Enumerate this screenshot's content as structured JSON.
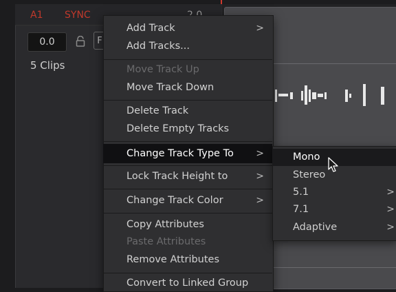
{
  "track_header": {
    "track_id": "A1",
    "sync_label": "SYNC",
    "track_number": "2.0",
    "volume": "0.0",
    "button_label": "F",
    "clips_count": "5 Clips"
  },
  "context_menu": {
    "items": [
      {
        "label": "Add Track"
      },
      {
        "label": "Add Tracks..."
      },
      {
        "label": "Move Track Up"
      },
      {
        "label": "Move Track Down"
      },
      {
        "label": "Delete Track"
      },
      {
        "label": "Delete Empty Tracks"
      },
      {
        "label": "Change Track Type To"
      },
      {
        "label": "Lock Track Height to"
      },
      {
        "label": "Change Track Color"
      },
      {
        "label": "Copy Attributes"
      },
      {
        "label": "Paste Attributes"
      },
      {
        "label": "Remove Attributes"
      },
      {
        "label": "Convert to Linked Group"
      }
    ],
    "submenu_arrow": ">"
  },
  "submenu": {
    "items": [
      {
        "label": "Mono"
      },
      {
        "label": "Stereo"
      },
      {
        "label": "5.1"
      },
      {
        "label": "7.1"
      },
      {
        "label": "Adaptive"
      }
    ]
  },
  "colors": {
    "accent_red": "#c0392b",
    "playhead": "#d23a2e",
    "menu_bg": "#2f2f31",
    "highlight": "#101012"
  }
}
